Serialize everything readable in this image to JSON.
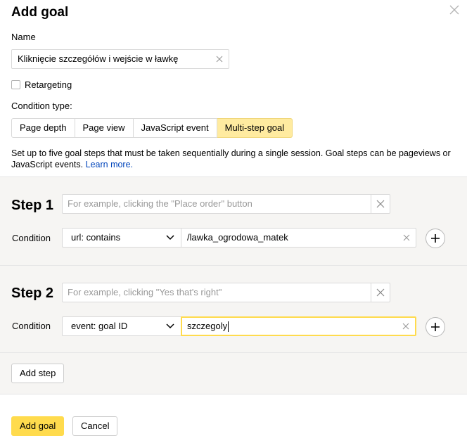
{
  "dialog": {
    "title": "Add goal",
    "name_label": "Name",
    "name_value": "Kliknięcie szczegółów i wejście w ławkę",
    "retargeting_label": "Retargeting",
    "retargeting_checked": false,
    "condition_type_label": "Condition type:",
    "condition_types": [
      {
        "label": "Page depth",
        "active": false
      },
      {
        "label": "Page view",
        "active": false
      },
      {
        "label": "JavaScript event",
        "active": false
      },
      {
        "label": "Multi-step goal",
        "active": true
      }
    ],
    "description": "Set up to five goal steps that must be taken sequentially during a single session. Goal steps can be pageviews or JavaScript events.",
    "learn_more": "Learn more."
  },
  "steps": [
    {
      "label": "Step 1",
      "name_placeholder": "For example, clicking the \"Place order\" button",
      "condition_label": "Condition",
      "condition_type": "url: contains",
      "condition_value": "/lawka_ogrodowa_matek"
    },
    {
      "label": "Step 2",
      "name_placeholder": "For example, clicking \"Yes that's right\"",
      "condition_label": "Condition",
      "condition_type": "event: goal ID",
      "condition_value": "szczegoly"
    }
  ],
  "buttons": {
    "add_step": "Add step",
    "add_goal": "Add goal",
    "cancel": "Cancel"
  },
  "colors": {
    "accent": "#ffdb4d",
    "active_tab": "#ffeba0",
    "link": "#0044bb",
    "section_bg": "#f6f5f3"
  }
}
